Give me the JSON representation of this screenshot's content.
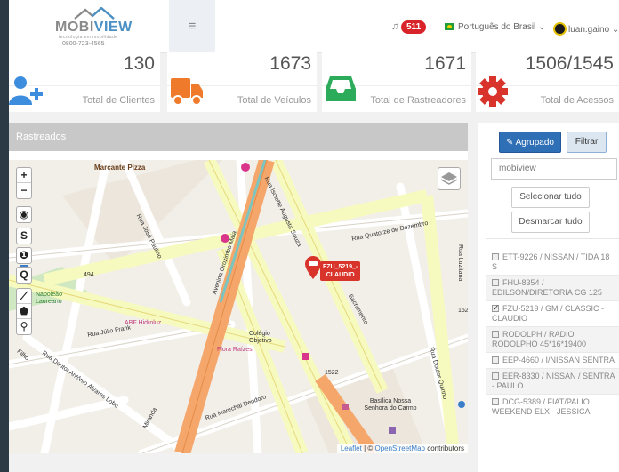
{
  "header": {
    "logo_brand_a": "MOBI",
    "logo_brand_b": "VIEW",
    "logo_tagline": "tecnologia em mobilidade",
    "logo_phone": "0800-723-4565",
    "menu_glyph": "≡",
    "notifications_count": "511",
    "language": "Português do Brasil ⌄",
    "username": "luan.gaino ⌄"
  },
  "stats": [
    {
      "value": "130",
      "label": "Total de Clientes",
      "icon": "add-user-icon",
      "color": "#3c8dde"
    },
    {
      "value": "1673",
      "label": "Total de Veículos",
      "icon": "truck-icon",
      "color": "#f07a2b"
    },
    {
      "value": "1671",
      "label": "Total de Rastreadores",
      "icon": "inbox-icon",
      "color": "#2cab5a"
    },
    {
      "value": "1506/1545",
      "label": "Total de Acessos",
      "icon": "gear-icon",
      "color": "#d9342b"
    }
  ],
  "panel": {
    "title": "Rastreados"
  },
  "map": {
    "zoom_in": "+",
    "zoom_out": "−",
    "streets": {
      "quatorze": "Rua Quatorze de Dezembro",
      "isolette": "Rua Isolette Augusta Souza",
      "orozimbo": "Avenida Orozimbo Maia",
      "paulino": "Rua José Paulino",
      "sacramento": "Sacramento",
      "julio": "Rua Júlio Frank",
      "alvares": "Rua Doutor Antônio Álvares Lobo",
      "deodoro": "Rua Marechal Deodoro",
      "quirino": "Rua Doutor Quirino",
      "luzitana": "Rua Luzitana"
    },
    "places": {
      "marcante": "Marcante Pizza",
      "napoleao": "Napoleão Laureano",
      "hidroluz": "ABF Hidroluz",
      "flora": "Flora Raízes",
      "colegio": "Colégio Objetivo",
      "basilica": "Basílica Nossa Senhora do Carmo",
      "num_494": "494",
      "num_1522": "1522",
      "num_152": "152",
      "filho": "Filho",
      "miranda": "Miranda"
    },
    "vehicle_plate": "FZU_5219_-",
    "vehicle_driver": "CLAUDIO",
    "attribution_leaflet": "Leaflet",
    "attribution_sep": " | © ",
    "attribution_osm": "OpenStreetMap",
    "attribution_tail": " contributors"
  },
  "side": {
    "agrupado": "Agrupado",
    "filtrar": "Filtrar",
    "search_value": "mobiview",
    "select_all": "Selecionar tudo",
    "deselect_all": "Desmarcar tudo",
    "items": [
      {
        "text": "ETT-9226 / NISSAN / TIDA 18 S",
        "checked": false
      },
      {
        "text": "FHU-8354 / EDILSON/DIRETORIA CG 125",
        "checked": false
      },
      {
        "text": "FZU-5219 / GM / CLASSIC - CLAUDIO",
        "checked": true
      },
      {
        "text": "RODOLPH / RADIO RODOLPHO 45*16*19400",
        "checked": false
      },
      {
        "text": "EEP-4660 / I/NISSAN SENTRA",
        "checked": false
      },
      {
        "text": "EER-8330 / NISSAN / SENTRA - PAULO",
        "checked": false
      },
      {
        "text": "DCG-5389 / FIAT/PALIO WEEKEND ELX - JESSICA",
        "checked": false
      }
    ]
  }
}
